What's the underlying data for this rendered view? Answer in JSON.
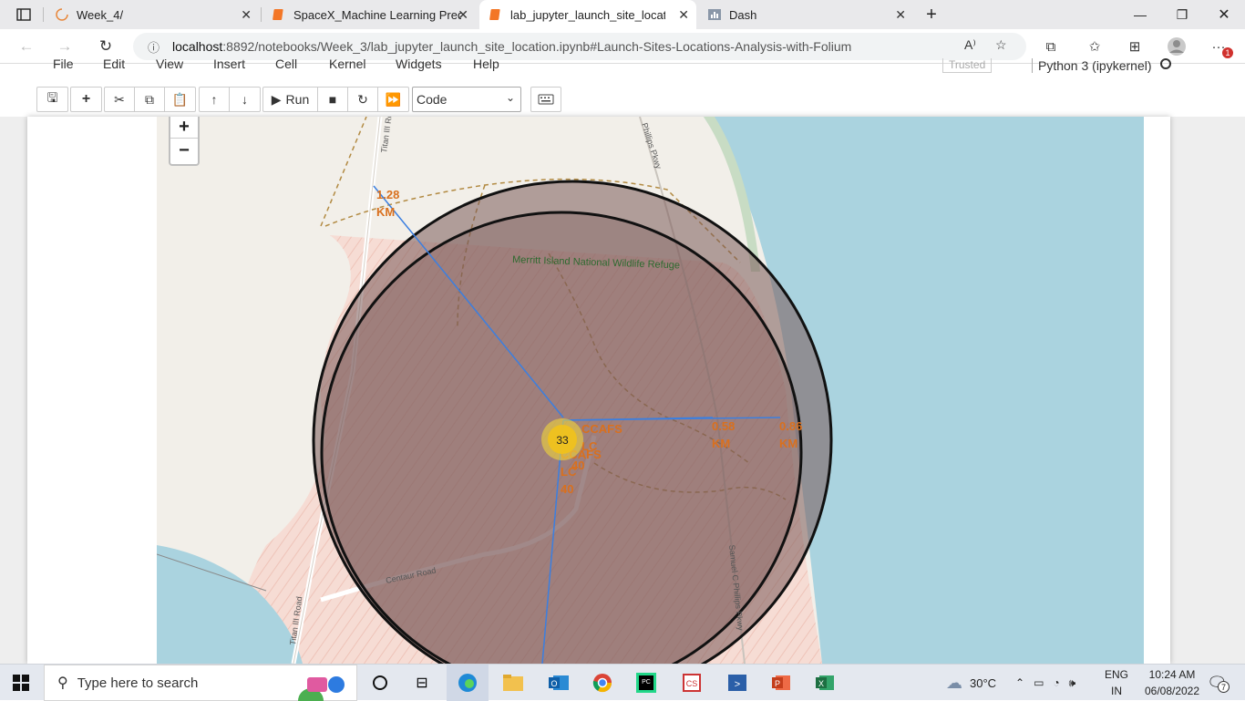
{
  "browser": {
    "tabs": [
      {
        "label": "Week_4/",
        "active": false
      },
      {
        "label": "SpaceX_Machine Learning Predic",
        "active": false
      },
      {
        "label": "lab_jupyter_launch_site_location",
        "active": true
      },
      {
        "label": "Dash",
        "active": false
      }
    ],
    "url_host": "localhost",
    "url_path": ":8892/notebooks/Week_3/lab_jupyter_launch_site_location.ipynb#Launch-Sites-Locations-Analysis-with-Folium",
    "profile_badge": "1"
  },
  "jupyter": {
    "menu": [
      "File",
      "Edit",
      "View",
      "Insert",
      "Cell",
      "Kernel",
      "Widgets",
      "Help"
    ],
    "trusted": "Trusted",
    "kernel": "Python 3 (ipykernel)",
    "run_label": "Run",
    "cell_type": "Code"
  },
  "map": {
    "zoom_in": "+",
    "zoom_out": "−",
    "road_titan_top": "Titan III Ro",
    "road_phillips_top": "Phillips Pkwy",
    "refuge_label": "Merritt Island National Wildlife Refuge",
    "road_samuel": "Samuel C Phillips Pkwy",
    "road_centaur": "Centaur Road",
    "road_titan_bottom": "Titan III Road",
    "cluster_count": "33",
    "site_labels": [
      {
        "line1": "CCAFS",
        "line2": "LC",
        "line3": "40"
      },
      {
        "line1": "CCAFS",
        "line2": "LC",
        "line3": "40"
      }
    ],
    "distances": [
      {
        "value": "1.28",
        "unit": "KM"
      },
      {
        "value": "0.58",
        "unit": "KM"
      },
      {
        "value": "0.86",
        "unit": "KM"
      }
    ],
    "colors": {
      "water": "#aad3df",
      "land": "#f2efe9",
      "circle_fill": "#7a5a58",
      "line": "#3b7fe0",
      "label": "#d9701e",
      "marker": "#f1c21b"
    }
  },
  "taskbar": {
    "search_placeholder": "Type here to search",
    "temperature": "30°C",
    "lang1": "ENG",
    "lang2": "IN",
    "time": "10:24 AM",
    "date": "06/08/2022",
    "notification_count": "7"
  }
}
